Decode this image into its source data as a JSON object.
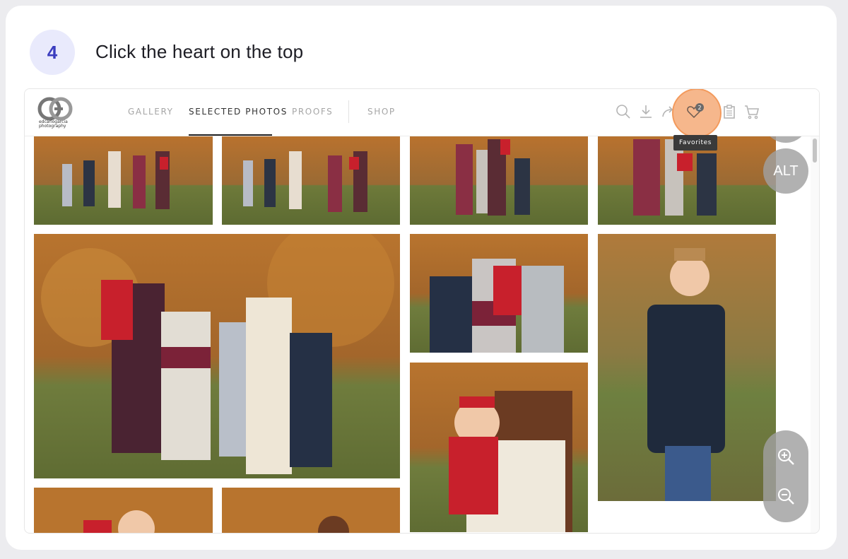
{
  "step": {
    "number": "4",
    "instruction": "Click the heart on the top"
  },
  "site": {
    "logo_text": "edcarlogarcia photography",
    "nav": [
      {
        "label": "GALLERY",
        "active": false
      },
      {
        "label": "SELECTED PHOTOS",
        "active": true
      },
      {
        "label": "PROOFS",
        "active": false
      },
      {
        "label": "SHOP",
        "active": false
      }
    ],
    "icons": [
      "search-icon",
      "download-icon",
      "share-icon",
      "heart-icon",
      "clipboard-icon",
      "cart-icon"
    ],
    "favorites_count": "2",
    "tooltip": "Favorites"
  },
  "floating": {
    "edit_icon": "pencil-icon",
    "alt_label": "ALT",
    "zoom_in_icon": "zoom-in-icon",
    "zoom_out_icon": "zoom-out-icon"
  },
  "colors": {
    "highlight": "#f6b183",
    "step_badge": "#e9eafc",
    "step_number": "#3b3dbf"
  }
}
